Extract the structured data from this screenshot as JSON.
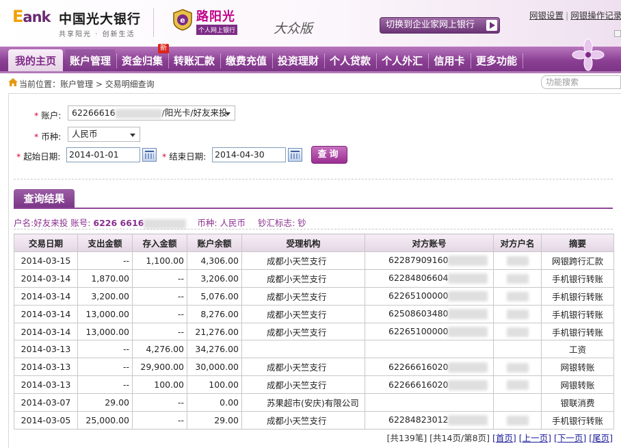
{
  "header": {
    "logo_e": "E",
    "logo_rest": "ank",
    "bank_name": "中国光大银行",
    "slogan": "共享阳光 · 创新生活",
    "sun_title": "路阳光",
    "sun_sub": "个人网上银行",
    "edition": "大众版",
    "switch_label": "切换到企业家网上银行",
    "links": [
      "网银设置",
      "网银操作记录"
    ]
  },
  "nav": {
    "items": [
      "我的主页",
      "账户管理",
      "资金归集",
      "转账汇款",
      "缴费充值",
      "投资理财",
      "个人贷款",
      "个人外汇",
      "信用卡",
      "更多功能"
    ],
    "active_index": 1,
    "new_badge": "新"
  },
  "breadcrumb": {
    "text": "当前位置：账户管理 > 交易明细查询"
  },
  "search": {
    "placeholder": "功能搜索"
  },
  "form": {
    "account_label": "账户:",
    "account_prefix": "62266616",
    "account_suffix": "/阳光卡/好友来投",
    "currency_label": "币种:",
    "currency_value": "人民币",
    "start_label": "起始日期:",
    "start_value": "2014-01-01",
    "end_label": "结束日期:",
    "end_value": "2014-04-30",
    "query_button": "查询"
  },
  "results": {
    "tab_label": "查询结果",
    "summary_name": "户名:好友来投",
    "summary_acct_label": "账号:",
    "summary_acct": "6226 6616",
    "summary_currency": "币种: 人民币",
    "summary_flag": "钞汇标志: 钞"
  },
  "table": {
    "headers": [
      "交易日期",
      "支出金额",
      "存入金额",
      "账户余额",
      "受理机构",
      "对方账号",
      "对方户名",
      "摘要"
    ],
    "rows": [
      [
        "2014-03-15",
        "--",
        "1,100.00",
        "4,306.00",
        "成都小天竺支行",
        "62287909160",
        "",
        "网银跨行汇款"
      ],
      [
        "2014-03-14",
        "1,870.00",
        "--",
        "3,206.00",
        "成都小天竺支行",
        "62284806604",
        "",
        "手机银行转账"
      ],
      [
        "2014-03-14",
        "3,200.00",
        "--",
        "5,076.00",
        "成都小天竺支行",
        "62265100000",
        "",
        "手机银行转账"
      ],
      [
        "2014-03-14",
        "13,000.00",
        "--",
        "8,276.00",
        "成都小天竺支行",
        "62508603480",
        "",
        "手机银行转账"
      ],
      [
        "2014-03-14",
        "13,000.00",
        "--",
        "21,276.00",
        "成都小天竺支行",
        "62265100000",
        "",
        "手机银行转账"
      ],
      [
        "2014-03-13",
        "--",
        "4,276.00",
        "34,276.00",
        "",
        "",
        "",
        "工资"
      ],
      [
        "2014-03-13",
        "--",
        "29,900.00",
        "30,000.00",
        "成都小天竺支行",
        "62266616020",
        "",
        "网银转账"
      ],
      [
        "2014-03-13",
        "--",
        "100.00",
        "100.00",
        "成都小天竺支行",
        "62266616020",
        "",
        "网银转账"
      ],
      [
        "2014-03-07",
        "29.00",
        "--",
        "0.00",
        "苏果超市(安庆)有限公司",
        "",
        "",
        "银联消费"
      ],
      [
        "2014-03-05",
        "25,000.00",
        "--",
        "29.00",
        "成都小天竺支行",
        "62284823012",
        "",
        "手机银行转账"
      ]
    ]
  },
  "pager": {
    "info": "[共139笔] [共14页/第8页]",
    "first": "[首页]",
    "prev": "[上一页]",
    "next": "[下一页]",
    "last": "[尾页]"
  },
  "colors": {
    "brand": "#7d2a86",
    "required": "#d4002f",
    "link": "#1a1a99"
  }
}
